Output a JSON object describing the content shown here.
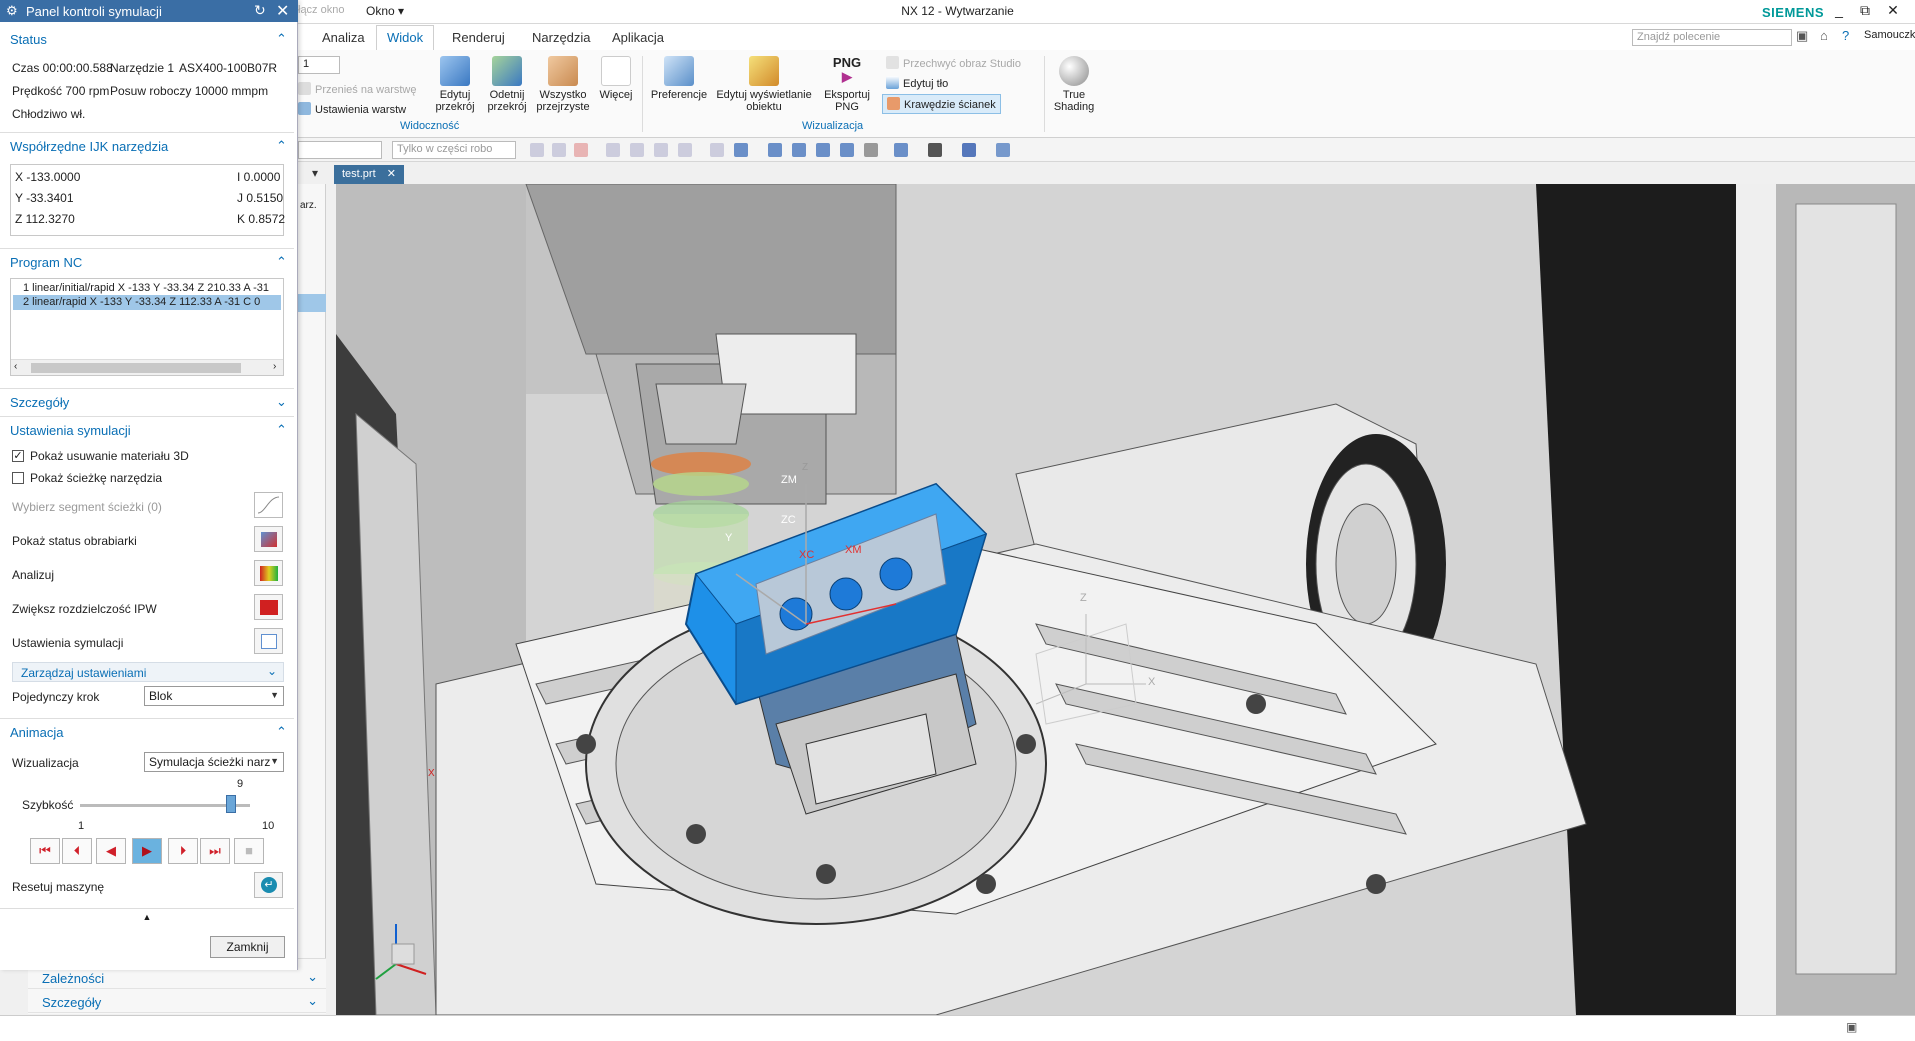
{
  "titlebar": {
    "quick_access": "łącz okno",
    "okno": "Okno ▾",
    "title": "NX 12 - Wytwarzanie",
    "brand": "SIEMENS",
    "min": "_",
    "restore": "⧉",
    "close": "✕"
  },
  "tabs": [
    {
      "label": "Analiza"
    },
    {
      "label": "Widok"
    },
    {
      "label": "Renderuj"
    },
    {
      "label": "Narzędzia"
    },
    {
      "label": "Aplikacja"
    }
  ],
  "search": {
    "placeholder": "Znajdź polecenie"
  },
  "user": {
    "name": "Samouczki"
  },
  "ribbon": {
    "combo_value": "1",
    "move_to_layer": "Przenieś na warstwę",
    "layer_settings": "Ustawienia warstw",
    "edit_section": "Edytuj\nprzekrój",
    "clip_section": "Odetnij\nprzekrój",
    "all_transparent": "Wszystko\nprzejrzyste",
    "more": "Więcej",
    "group_visibility": "Widoczność",
    "preferences": "Preferencje",
    "edit_display": "Edytuj wyświetlanie\nobiektu",
    "export_png_icon": "PNG",
    "export_png": "Eksportuj\nPNG",
    "preview_studio": "Przechwyć obraz Studio",
    "edit_background": "Edytuj tło",
    "face_edges": "Krawędzie ścianek",
    "group_visualization": "Wizualizacja",
    "true_shading": "True\nShading"
  },
  "toolbar2": {
    "filter_value": "Tylko w części robo"
  },
  "doctab": {
    "label": "test.prt"
  },
  "nav": {
    "partial_label": "arz.",
    "dependencies": "Zależności",
    "details": "Szczegóły"
  },
  "panel": {
    "title": "Panel kontroli symulacji",
    "status": {
      "header": "Status",
      "time": "Czas 00:00:00.588",
      "tool_no": "Narzędzie 1",
      "tool_name": "ASX400-100B07R",
      "speed": "Prędkość 700 rpm",
      "feed": "Posuw roboczy 10000 mmpm",
      "coolant": "Chłodziwo wł."
    },
    "ijk": {
      "header": "Współrzędne IJK narzędzia",
      "x": "X -133.0000",
      "y": "Y -33.3401",
      "z": "Z 112.3270",
      "i": "I 0.0000",
      "j": "J 0.5150",
      "k": "K 0.8572"
    },
    "nc": {
      "header": "Program NC",
      "lines": [
        "1 linear/initial/rapid X -133 Y -33.34 Z 210.33 A -31",
        "2 linear/rapid X -133 Y -33.34 Z 112.33 A -31 C 0"
      ]
    },
    "details": {
      "header": "Szczegóły"
    },
    "settings": {
      "header": "Ustawienia symulacji",
      "show_material_removal": "Pokaż usuwanie materiału 3D",
      "show_tool_path": "Pokaż ścieżkę narzędzia",
      "select_segment": "Wybierz segment ścieżki (0)",
      "show_machine_status": "Pokaż status obrabiarki",
      "analyze": "Analizuj",
      "increase_ipw": "Zwiększ rozdzielczość IPW",
      "sim_settings": "Ustawienia symulacji",
      "manage_settings": "Zarządzaj ustawieniami",
      "single_step_label": "Pojedynczy krok",
      "single_step_value": "Blok"
    },
    "animation": {
      "header": "Animacja",
      "visualization_label": "Wizualizacja",
      "visualization_value": "Symulacja ścieżki narz",
      "speed_label": "Szybkość",
      "speed_value": "9",
      "speed_min": "1",
      "speed_max": "10",
      "speed_fraction": 0.889,
      "reset_machine": "Resetuj maszynę"
    },
    "buttons": {
      "first": "⏮",
      "prev_step": "⏴",
      "reverse": "◀",
      "play": "▶",
      "next_step": "⏵",
      "last": "⏭",
      "stop": "■",
      "collapse": "▲",
      "close": "Zamknij"
    }
  },
  "axes": {
    "zm": "ZM",
    "zc": "ZC",
    "xc": "XC",
    "xm": "XM",
    "y": "Y",
    "z_small": "Z",
    "x_small": "X",
    "z2": "Z",
    "x2": "X"
  },
  "colors": {
    "accent": "#0a6fb5",
    "panel_header": "#3a6ea5",
    "workpiece": "#1e90e8",
    "brand": "#009999"
  }
}
